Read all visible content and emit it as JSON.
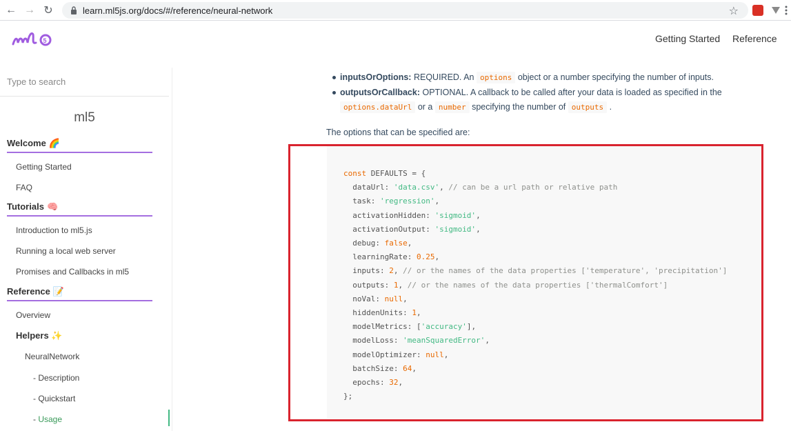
{
  "browser": {
    "url": "learn.ml5js.org/docs/#/reference/neural-network"
  },
  "header": {
    "logo_text": "ml5",
    "nav": [
      "Getting Started",
      "Reference"
    ]
  },
  "sidebar": {
    "search_placeholder": "Type to search",
    "title": "ml5",
    "sections": {
      "welcome": {
        "label": "Welcome",
        "emoji": "🌈"
      },
      "tutorials": {
        "label": "Tutorials",
        "emoji": "🧠"
      },
      "reference": {
        "label": "Reference",
        "emoji": "📝"
      }
    },
    "items": {
      "getting_started": "Getting Started",
      "faq": "FAQ",
      "intro": "Introduction to ml5.js",
      "local_server": "Running a local web server",
      "promises": "Promises and Callbacks in ml5",
      "overview": "Overview",
      "helpers": "Helpers",
      "helpers_emoji": "✨",
      "neural_network": "NeuralNetwork",
      "description": "- Description",
      "quickstart": "- Quickstart",
      "usage_prefix": "- ",
      "usage": "Usage"
    }
  },
  "content": {
    "bullet1": {
      "name": "inputsOrOptions:",
      "text1": "REQUIRED. An",
      "code1": "options",
      "text2": "object or a number specifying the number of inputs."
    },
    "bullet2": {
      "name": "outputsOrCallback:",
      "text1": "OPTIONAL. A callback to be called after your data is loaded as specified in the",
      "code1": "options.dataUrl",
      "text2": "or a",
      "code2": "number",
      "text3": "specifying the number of",
      "code3": "outputs",
      "text4": "."
    },
    "options_intro": "The options that can be specified are:",
    "code_lines": [
      [
        [
          "kw",
          "const"
        ],
        [
          "plain",
          " DEFAULTS = {"
        ]
      ],
      [
        [
          "plain",
          "  dataUrl: "
        ],
        [
          "str",
          "'data.csv'"
        ],
        [
          "plain",
          ", "
        ],
        [
          "com",
          "// can be a url path or relative path"
        ]
      ],
      [
        [
          "plain",
          "  task: "
        ],
        [
          "str",
          "'regression'"
        ],
        [
          "plain",
          ","
        ]
      ],
      [
        [
          "plain",
          "  activationHidden: "
        ],
        [
          "str",
          "'sigmoid'"
        ],
        [
          "plain",
          ","
        ]
      ],
      [
        [
          "plain",
          "  activationOutput: "
        ],
        [
          "str",
          "'sigmoid'"
        ],
        [
          "plain",
          ","
        ]
      ],
      [
        [
          "plain",
          "  debug: "
        ],
        [
          "num",
          "false"
        ],
        [
          "plain",
          ","
        ]
      ],
      [
        [
          "plain",
          "  learningRate: "
        ],
        [
          "num",
          "0.25"
        ],
        [
          "plain",
          ","
        ]
      ],
      [
        [
          "plain",
          "  inputs: "
        ],
        [
          "num",
          "2"
        ],
        [
          "plain",
          ", "
        ],
        [
          "com",
          "// or the names of the data properties ['temperature', 'precipitation']"
        ]
      ],
      [
        [
          "plain",
          "  outputs: "
        ],
        [
          "num",
          "1"
        ],
        [
          "plain",
          ", "
        ],
        [
          "com",
          "// or the names of the data properties ['thermalComfort']"
        ]
      ],
      [
        [
          "plain",
          "  noVal: "
        ],
        [
          "num",
          "null"
        ],
        [
          "plain",
          ","
        ]
      ],
      [
        [
          "plain",
          "  hiddenUnits: "
        ],
        [
          "num",
          "1"
        ],
        [
          "plain",
          ","
        ]
      ],
      [
        [
          "plain",
          "  modelMetrics: ["
        ],
        [
          "str",
          "'accuracy'"
        ],
        [
          "plain",
          "],"
        ]
      ],
      [
        [
          "plain",
          "  modelLoss: "
        ],
        [
          "str",
          "'meanSquaredError'"
        ],
        [
          "plain",
          ","
        ]
      ],
      [
        [
          "plain",
          "  modelOptimizer: "
        ],
        [
          "num",
          "null"
        ],
        [
          "plain",
          ","
        ]
      ],
      [
        [
          "plain",
          "  batchSize: "
        ],
        [
          "num",
          "64"
        ],
        [
          "plain",
          ","
        ]
      ],
      [
        [
          "plain",
          "  epochs: "
        ],
        [
          "num",
          "32"
        ],
        [
          "plain",
          ","
        ]
      ],
      [
        [
          "plain",
          "};"
        ]
      ]
    ]
  },
  "colors": {
    "accent_purple": "#a46ee0",
    "highlight_red": "#d9232e",
    "active_green": "#42b983"
  }
}
